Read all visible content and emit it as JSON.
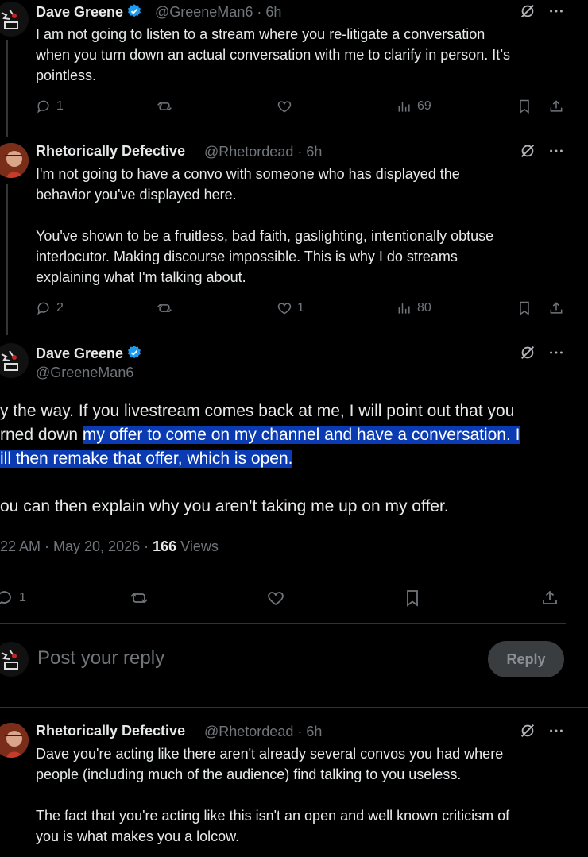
{
  "tweets": [
    {
      "name": "Dave Greene",
      "handle": "@GreeneMan6 · 6h",
      "text": "I am not going to listen to a stream where you re-litigate a conversation\nwhen you turn down an actual conversation with me to clarify in person. It’s\npointless.",
      "replies": "1",
      "likes": "",
      "views": "69"
    },
    {
      "name": "Rhetorically Defective",
      "handle": "@Rhetordead · 6h",
      "text": "I'm not going to have a convo with someone who has displayed the\nbehavior you've displayed here.\n\nYou've shown to be a fruitless, bad faith, gaslighting, intentionally obtuse\ninterlocutor. Making discourse impossible. This is why I do streams\nexplaining what I'm talking about.",
      "replies": "2",
      "likes": "1",
      "views": "80"
    }
  ],
  "main_tweet": {
    "name": "Dave Greene",
    "handle": "@GreeneMan6",
    "line1": "y the way. If you livestream comes back at me, I will point out that you",
    "line2_plain": "rned down ",
    "line2_hl": "my offer to come on my channel and have a conversation. I ",
    "line3_hl": "ill then remake that offer, which is open.",
    "line4": "ou can then explain why you aren’t taking me up on my offer.",
    "timestamp": "22 AM · May 20, 2026 · ",
    "views_count": "166",
    "views_label": " Views",
    "replies": "1"
  },
  "compose": {
    "placeholder": "Post your reply",
    "button": "Reply"
  },
  "reply_tweet": {
    "name": "Rhetorically Defective",
    "handle": "@Rhetordead · 6h",
    "text": "Dave you're acting like there aren't already several convos you had where\npeople (including much of the audience) find talking to you useless.\n\nThe fact that you're acting like this isn't an open and well known criticism of\nyou is what makes you a lolcow."
  },
  "colors": {
    "verified": "#1d9bf0",
    "highlight": "#0a3bb3",
    "muted": "#71767b"
  }
}
